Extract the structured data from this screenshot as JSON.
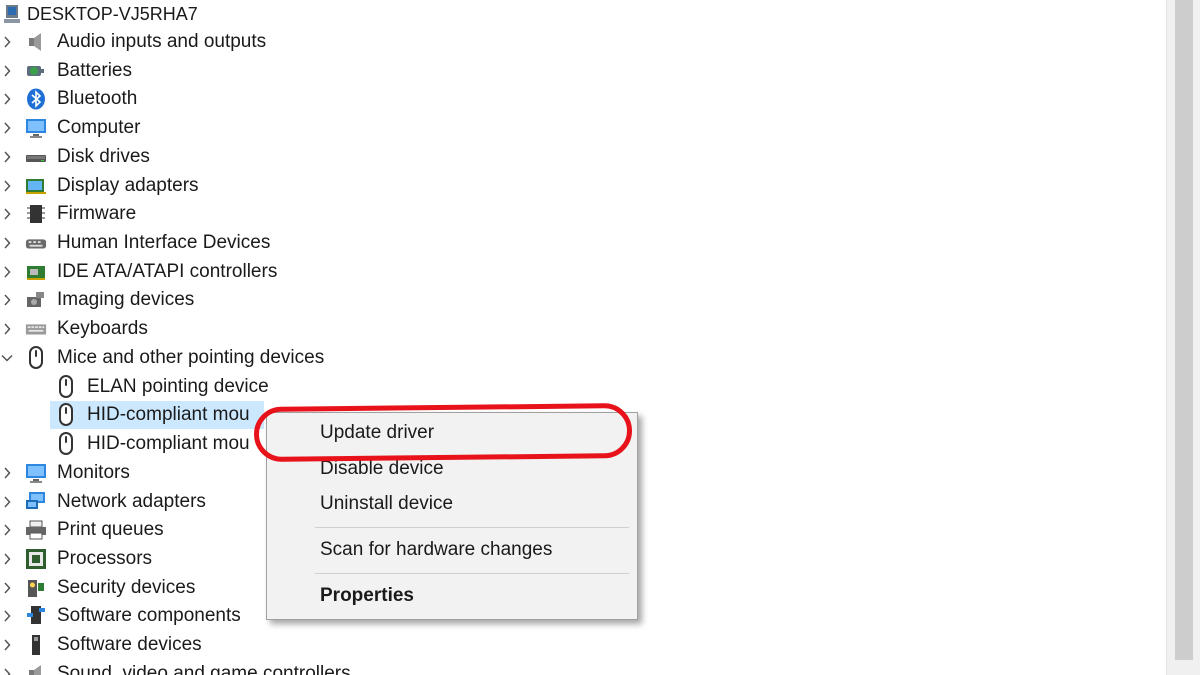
{
  "root": {
    "label": "DESKTOP-VJ5RHA7",
    "icon": "computer-root-icon"
  },
  "tree": [
    {
      "label": "Audio inputs and outputs",
      "icon": "speaker-icon",
      "name": "audio-inputs-and-outputs"
    },
    {
      "label": "Batteries",
      "icon": "battery-icon",
      "name": "batteries"
    },
    {
      "label": "Bluetooth",
      "icon": "bluetooth-icon",
      "name": "bluetooth"
    },
    {
      "label": "Computer",
      "icon": "monitor-icon",
      "name": "computer"
    },
    {
      "label": "Disk drives",
      "icon": "disk-drive-icon",
      "name": "disk-drives"
    },
    {
      "label": "Display adapters",
      "icon": "display-adapter-icon",
      "name": "display-adapters"
    },
    {
      "label": "Firmware",
      "icon": "firmware-icon",
      "name": "firmware"
    },
    {
      "label": "Human Interface Devices",
      "icon": "hid-icon",
      "name": "human-interface-devices"
    },
    {
      "label": "IDE ATA/ATAPI controllers",
      "icon": "ide-controller-icon",
      "name": "ide-controllers"
    },
    {
      "label": "Imaging devices",
      "icon": "camera-icon",
      "name": "imaging-devices"
    },
    {
      "label": "Keyboards",
      "icon": "keyboard-icon",
      "name": "keyboards"
    },
    {
      "label": "Mice and other pointing devices",
      "icon": "mouse-icon",
      "name": "mice-and-pointing-devices",
      "expanded": true
    },
    {
      "label": "ELAN pointing device",
      "icon": "mouse-icon",
      "name": "elan-pointing-device",
      "child": true
    },
    {
      "label": "HID-compliant mou",
      "icon": "mouse-icon",
      "name": "hid-compliant-mouse-1",
      "child": true,
      "selected": true
    },
    {
      "label": "HID-compliant mou",
      "icon": "mouse-icon",
      "name": "hid-compliant-mouse-2",
      "child": true
    },
    {
      "label": "Monitors",
      "icon": "monitor-icon",
      "name": "monitors"
    },
    {
      "label": "Network adapters",
      "icon": "network-icon",
      "name": "network-adapters"
    },
    {
      "label": "Print queues",
      "icon": "printer-icon",
      "name": "print-queues"
    },
    {
      "label": "Processors",
      "icon": "processor-icon",
      "name": "processors"
    },
    {
      "label": "Security devices",
      "icon": "security-key-icon",
      "name": "security-devices"
    },
    {
      "label": "Software components",
      "icon": "software-component-icon",
      "name": "software-components"
    },
    {
      "label": "Software devices",
      "icon": "software-device-icon",
      "name": "software-devices"
    },
    {
      "label": "Sound, video and game controllers",
      "icon": "speaker-icon",
      "name": "sound-video-game-controllers"
    }
  ],
  "context_menu": {
    "update_driver": "Update driver",
    "disable_device": "Disable device",
    "uninstall_device": "Uninstall device",
    "scan_for_hardware_changes": "Scan for hardware changes",
    "properties": "Properties"
  },
  "colors": {
    "selection": "#cce8ff",
    "highlight": "#e8121b"
  }
}
